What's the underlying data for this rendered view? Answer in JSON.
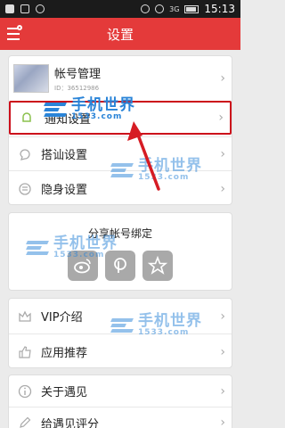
{
  "statusbar": {
    "network": "3G",
    "time": "15:13"
  },
  "title": "设置",
  "account": {
    "name": "帐号管理",
    "id": "ID：36512986"
  },
  "settings": [
    {
      "label": "通知设置"
    },
    {
      "label": "搭讪设置"
    },
    {
      "label": "隐身设置"
    }
  ],
  "share": {
    "title": "分享帐号绑定",
    "icons": [
      "weibo-icon",
      "pengyou-icon",
      "star-icon"
    ]
  },
  "more": [
    {
      "label": "VIP介绍"
    },
    {
      "label": "应用推荐"
    }
  ],
  "about": [
    {
      "label": "关于遇见"
    },
    {
      "label": "给遇见评分"
    }
  ],
  "chevron": "›",
  "watermark": {
    "text": "手机世界",
    "number": "1533.com"
  },
  "colors": {
    "titlebar": "#e43a3a",
    "highlight": "#cc0f1b",
    "watermark": "#2a84d8"
  }
}
